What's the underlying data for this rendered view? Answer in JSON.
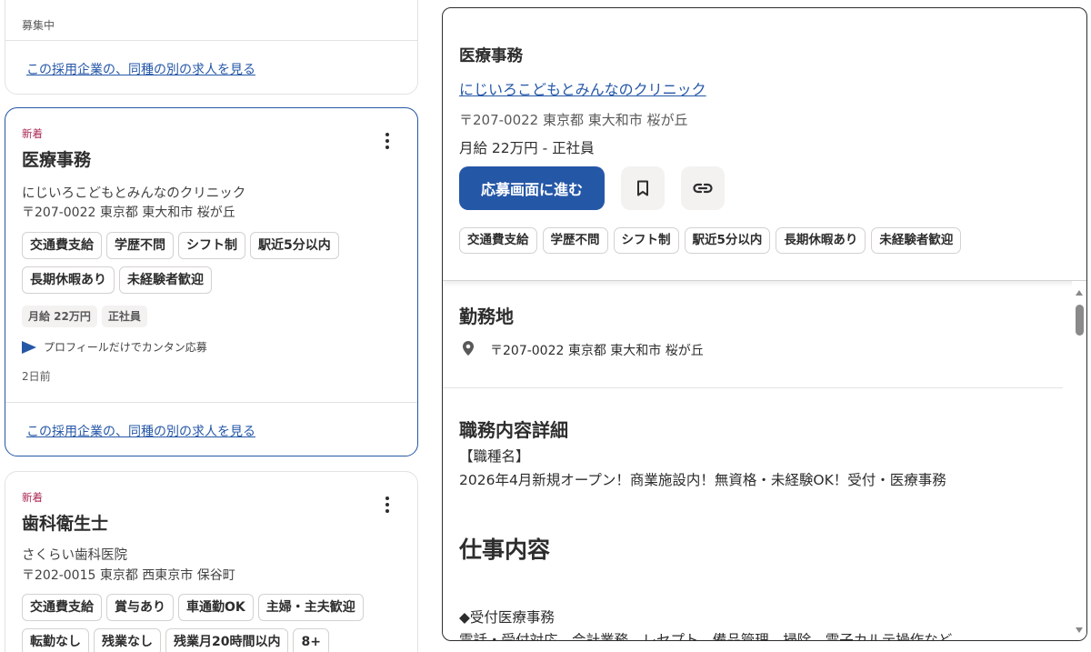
{
  "left_list": {
    "card0": {
      "status": "募集中",
      "link": "この採用企業の、同種の別の求人を見る"
    },
    "card1": {
      "badge": "新着",
      "title": "医療事務",
      "company": "にじいろこどもとみんなのクリニック",
      "location": "〒207-0022 東京都 東大和市 桜が丘",
      "tags": [
        "交通費支給",
        "学歴不問",
        "シフト制",
        "駅近5分以内",
        "長期休暇あり",
        "未経験者歓迎"
      ],
      "pills": [
        "月給 22万円",
        "正社員"
      ],
      "easy_apply": "プロフィールだけでカンタン応募",
      "posted": "2日前",
      "link": "この採用企業の、同種の別の求人を見る"
    },
    "card2": {
      "badge": "新着",
      "title": "歯科衛生士",
      "company": "さくらい歯科医院",
      "location": "〒202-0015 東京都 西東京市 保谷町",
      "tags": [
        "交通費支給",
        "賞与あり",
        "車通勤OK",
        "主婦・主夫歓迎",
        "転勤なし",
        "残業なし",
        "残業月20時間以内",
        "8+"
      ]
    }
  },
  "detail": {
    "title": "医療事務",
    "company": "にじいろこどもとみんなのクリニック",
    "location": "〒207-0022 東京都 東大和市 桜が丘",
    "salary": "月給 22万円 - 正社員",
    "apply_label": "応募画面に進む",
    "tags": [
      "交通費支給",
      "学歴不問",
      "シフト制",
      "駅近5分以内",
      "長期休暇あり",
      "未経験者歓迎"
    ],
    "workplace_heading": "勤務地",
    "workplace_address": "〒207-0022 東京都 東大和市 桜が丘",
    "details_heading": "職務内容詳細",
    "job_name_label": "【職種名】",
    "job_name": "2026年4月新規オープン！商業施設内！無資格・未経験OK！受付・医療事務",
    "work_heading": "仕事内容",
    "work_item": "◆受付医療事務",
    "work_desc": "電話・受付対応、会計業務、レセプト、備品管理、掃除、電子カルテ操作など"
  },
  "colors": {
    "accent": "#2557a7",
    "new_badge": "#a9254f"
  }
}
